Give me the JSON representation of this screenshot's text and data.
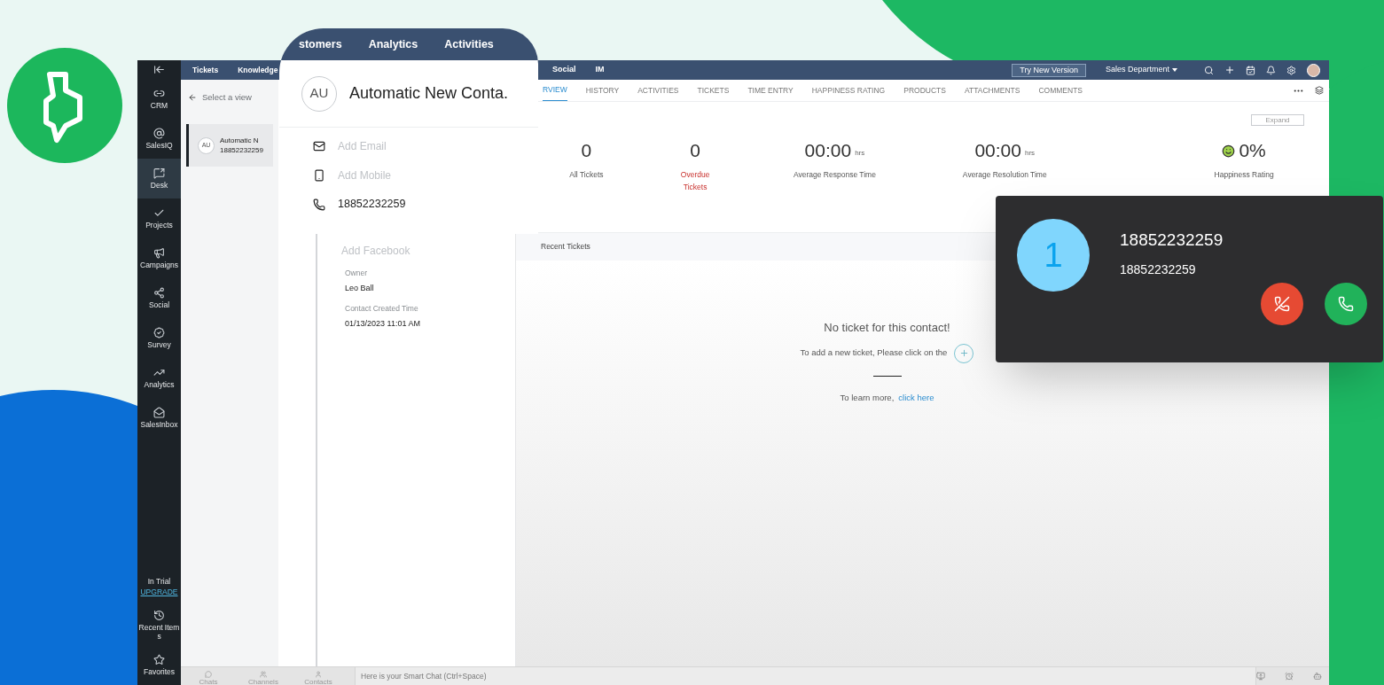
{
  "sidebar": {
    "items": [
      {
        "kind": "crm",
        "label": "CRM",
        "selected": false
      },
      {
        "kind": "salesiq",
        "label": "SalesIQ",
        "selected": false
      },
      {
        "kind": "desk",
        "label": "Desk",
        "selected": true
      },
      {
        "kind": "projects",
        "label": "Projects",
        "selected": false
      },
      {
        "kind": "campaigns",
        "label": "Campaigns",
        "selected": false
      },
      {
        "kind": "social",
        "label": "Social",
        "selected": false
      },
      {
        "kind": "survey",
        "label": "Survey",
        "selected": false
      },
      {
        "kind": "analytics",
        "label": "Analytics",
        "selected": false
      },
      {
        "kind": "salesinbox",
        "label": "SalesInbox",
        "selected": false
      }
    ],
    "trial": {
      "label": "In Trial",
      "link": "UPGRADE"
    },
    "bottom_items": [
      {
        "kind": "recent",
        "label": "Recent Items"
      },
      {
        "kind": "favorites",
        "label": "Favorites"
      }
    ]
  },
  "top_bar": {
    "tabs": [
      "Tickets",
      "Knowledge"
    ],
    "tabs_right": [
      "Social",
      "IM"
    ],
    "try_button": "Try New Version",
    "department": "Sales Department"
  },
  "magnifier": {
    "tabs": [
      "stomers",
      "Analytics",
      "Activities"
    ]
  },
  "list_panel": {
    "view_selector": "Select a view",
    "contacts": [
      {
        "initials": "AU",
        "name": "Automatic N",
        "phone": "18852232259",
        "selected": true
      }
    ]
  },
  "contact": {
    "initials": "AU",
    "name": "Automatic New Conta.",
    "fields": [
      {
        "kind": "email",
        "placeholder": "Add Email"
      },
      {
        "kind": "mobile",
        "placeholder": "Add Mobile"
      },
      {
        "kind": "phone",
        "value": "18852232259"
      }
    ],
    "facebook": {
      "placeholder": "Add Facebook"
    },
    "info": [
      {
        "label": "Owner",
        "value": "Leo Ball"
      },
      {
        "label": "Contact Created Time",
        "value": "01/13/2023 11:01 AM"
      }
    ]
  },
  "detail": {
    "tabs": [
      {
        "label": "RVIEW",
        "selected": true
      },
      {
        "label": "HISTORY",
        "selected": false
      },
      {
        "label": "ACTIVITIES",
        "selected": false
      },
      {
        "label": "TICKETS",
        "selected": false
      },
      {
        "label": "TIME ENTRY",
        "selected": false
      },
      {
        "label": "HAPPINESS RATING",
        "selected": false
      },
      {
        "label": "PRODUCTS",
        "selected": false
      },
      {
        "label": "ATTACHMENTS",
        "selected": false
      },
      {
        "label": "COMMENTS",
        "selected": false
      }
    ],
    "expand_button": "Expand",
    "stats": [
      {
        "kind": "count",
        "value": "0",
        "label": "All Tickets",
        "alert": false
      },
      {
        "kind": "count",
        "value": "0",
        "label": "Overdue Tickets",
        "alert": true
      },
      {
        "kind": "time",
        "value": "00:00",
        "unit": "hrs",
        "label": "Average Response Time",
        "alert": false
      },
      {
        "kind": "time",
        "value": "00:00",
        "unit": "hrs",
        "label": "Average Resolution Time",
        "alert": false
      },
      {
        "kind": "rating",
        "value": "0%",
        "label": "Happiness Rating",
        "alert": false
      }
    ],
    "recent_tickets": {
      "title": "Recent Tickets",
      "empty_title": "No ticket for this contact!",
      "hint": "To add a new ticket, Please click on the",
      "learn_more": "To learn more,",
      "link": "click here"
    }
  },
  "chat_bar": {
    "tabs": [
      {
        "kind": "chats",
        "label": "Chats"
      },
      {
        "kind": "channels",
        "label": "Channels"
      },
      {
        "kind": "contacts",
        "label": "Contacts"
      }
    ],
    "placeholder": "Here is your Smart Chat (Ctrl+Space)"
  },
  "call_popup": {
    "avatar": "1",
    "title": "18852232259",
    "subtitle": "18852232259"
  }
}
